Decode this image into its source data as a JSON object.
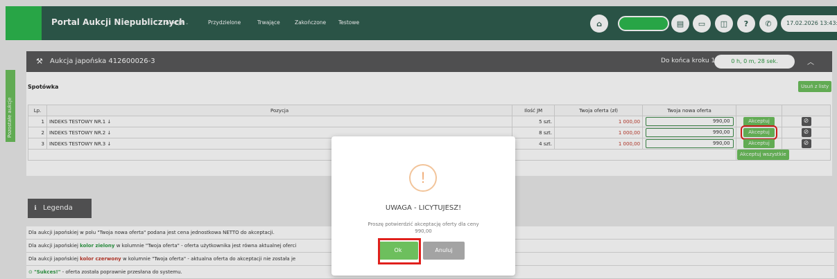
{
  "header": {
    "app_title": "Portal Aukcji Niepublicznych",
    "nav": [
      {
        "label": "Aukcje",
        "has_dropdown": true
      },
      {
        "label": "Przydzielone"
      },
      {
        "label": "Trwające"
      },
      {
        "label": "Zakończone"
      },
      {
        "label": "Testowe"
      }
    ],
    "datetime": "17.02.2026 13:43:3",
    "icons": [
      "home-icon",
      "document-icon",
      "printer-icon",
      "book-icon",
      "help-icon",
      "phone-icon"
    ]
  },
  "side_tab": {
    "label": "Pozostałe aukcje"
  },
  "auction": {
    "title": "Aukcja japońska 412600026-3",
    "countdown_label": "Do końca kroku 1",
    "countdown_value": "0 h, 0 m, 28 sek.",
    "section": "Spotówka",
    "remove_label": "Usuń z listy",
    "table": {
      "headers": [
        "Lp.",
        "Pozycja",
        "Ilość JM",
        "Twoja oferta (zł)",
        "Twoja nowa oferta"
      ],
      "rows": [
        {
          "lp": "1",
          "pos": "INDEKS TESTOWY NR.1 ↓",
          "qty": "5 szt.",
          "offer": "1 000,00",
          "new_offer": "990,00",
          "accept": "Akceptuj"
        },
        {
          "lp": "2",
          "pos": "INDEKS TESTOWY NR.2 ↓",
          "qty": "8 szt.",
          "offer": "1 000,00",
          "new_offer": "990,00",
          "accept": "Akceptuj"
        },
        {
          "lp": "3",
          "pos": "INDEKS TESTOWY NR.3 ↓",
          "qty": "4 szt.",
          "offer": "1 000,00",
          "new_offer": "990,00",
          "accept": "Akceptuj"
        }
      ],
      "accept_all": "Akceptuj wszystkie"
    }
  },
  "legend": {
    "title": "Legenda",
    "row1": "Dla aukcji japońskiej w polu \"Twoja nowa oferta\" podana jest cena jednostkowa NETTO do akceptacji.",
    "row2_pre": "Dla aukcji japońskiej ",
    "row2_kw": "kolor zielony",
    "row2_post": " w kolumnie \"Twoja oferta\" - oferta użytkownika jest równa aktualnej oferci",
    "row3_pre": "Dla aukcji japońskiej ",
    "row3_kw": "kolor czerwony",
    "row3_post": " w kolumnie \"Twoja oferta\" - aktualna oferta do akceptacji nie została je",
    "row4_kw": "\"Sukces!\"",
    "row4_post": " - oferta została poprawnie przesłana do systemu."
  },
  "modal": {
    "title": "UWAGA - LICYTUJESZ!",
    "text": "Proszę potwierdzić akceptację oferty dla ceny",
    "price": "990,00",
    "ok_label": "Ok",
    "cancel_label": "Anuluj"
  },
  "colors": {
    "header_bg": "#2f5d4f",
    "accent_green": "#6dbf5d",
    "highlight_red": "#e0201c",
    "panel_gray": "#58595a"
  }
}
